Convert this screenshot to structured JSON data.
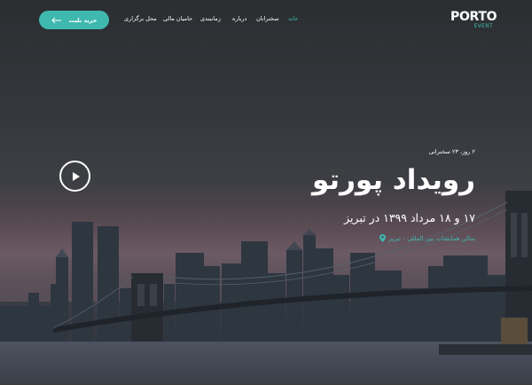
{
  "brand": {
    "logo_main": "PORTO",
    "logo_sub": "EVENT"
  },
  "nav": {
    "items": [
      {
        "label": "خانه",
        "active": true
      },
      {
        "label": "سخنرانان",
        "active": false
      },
      {
        "label": "درباره",
        "active": false
      },
      {
        "label": "زمانبندی",
        "active": false
      },
      {
        "label": "حامیان مالی",
        "active": false
      },
      {
        "label": "محل برگزاری",
        "active": false
      }
    ]
  },
  "cta": {
    "label": "خرید بلیت",
    "icon": "arrow-left-icon"
  },
  "hero": {
    "meta": "۲ روز، ۲۳ سخنرانی",
    "title": "رویداد پورتو",
    "date": "۱۷ و ۱۸ مرداد ۱۳۹۹ در تبریز",
    "venue": "سالن همایشات بین المللی - تبریز",
    "venue_icon": "map-pin-icon",
    "play_icon": "play-icon"
  },
  "colors": {
    "accent": "#3fb8af",
    "text": "#ffffff"
  }
}
